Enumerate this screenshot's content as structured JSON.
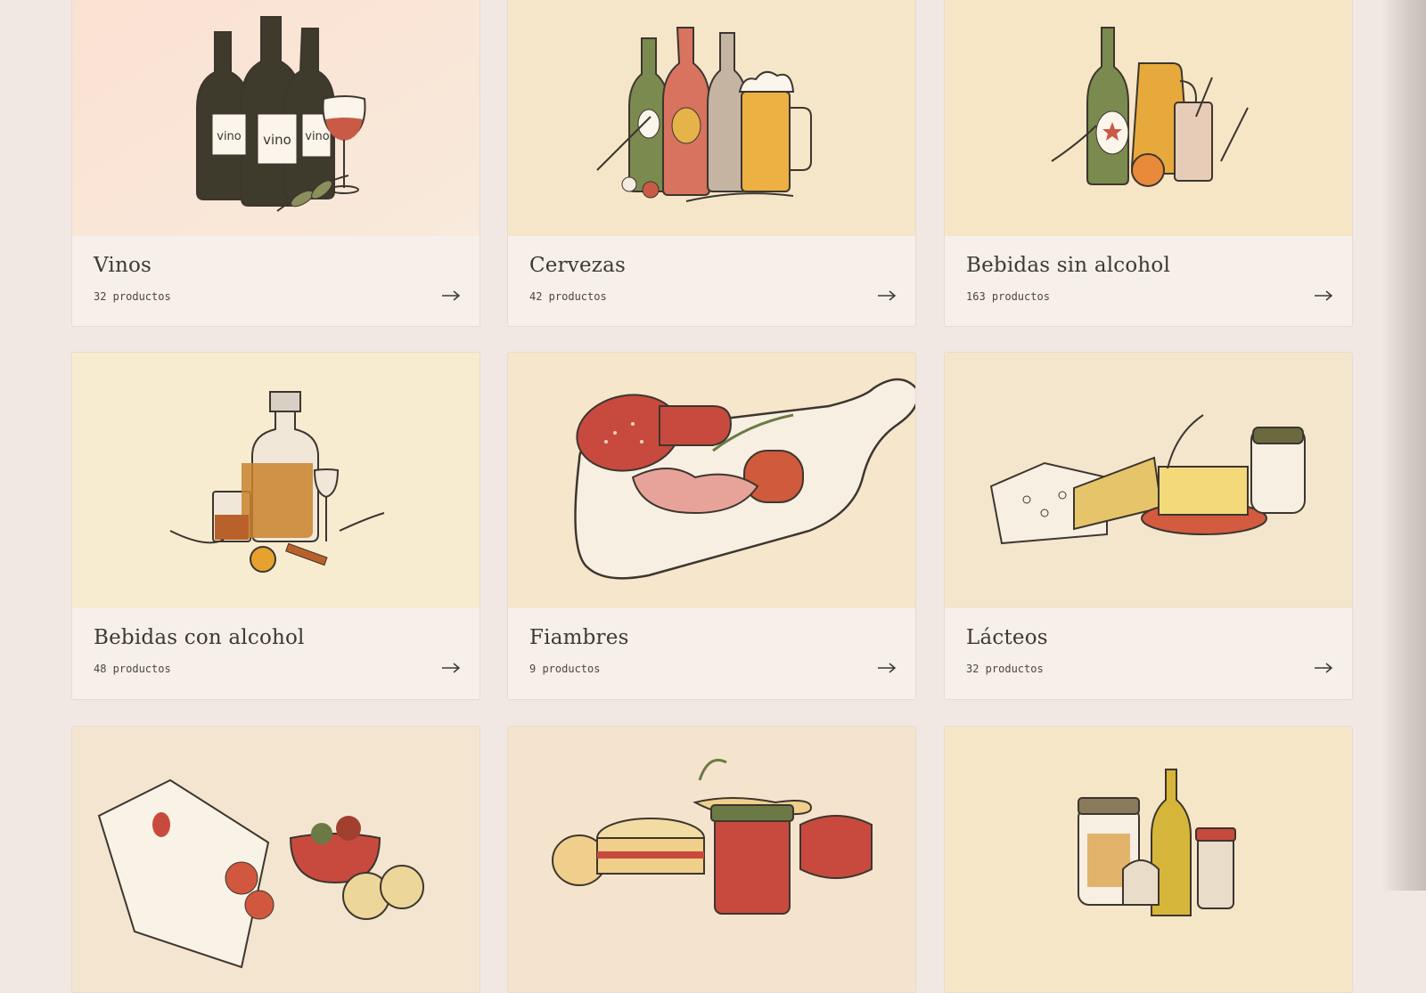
{
  "categories": [
    {
      "title": "Vinos",
      "count": "32 productos",
      "image": "wine-bottles-illustration"
    },
    {
      "title": "Cervezas",
      "count": "42 productos",
      "image": "beer-bottles-illustration"
    },
    {
      "title": "Bebidas sin alcohol",
      "count": "163 productos",
      "image": "soft-drinks-illustration"
    },
    {
      "title": "Bebidas con alcohol",
      "count": "48 productos",
      "image": "liquor-decanter-illustration"
    },
    {
      "title": "Fiambres",
      "count": "9 productos",
      "image": "cold-cuts-board-illustration"
    },
    {
      "title": "Lácteos",
      "count": "32 productos",
      "image": "cheese-butter-illustration"
    },
    {
      "title": "",
      "count": "",
      "image": "snacks-illustration"
    },
    {
      "title": "",
      "count": "",
      "image": "bakery-jams-illustration"
    },
    {
      "title": "",
      "count": "",
      "image": "pantry-jars-illustration"
    }
  ],
  "bottle_labels": {
    "left": "vino",
    "middle": "vino",
    "right": "vino"
  },
  "icons": {
    "card_arrow": "arrow-right-icon"
  },
  "colors": {
    "page_bg": "#f1e8e3",
    "card_bg": "#f7f0ea",
    "ink": "#3f3933",
    "accent_red": "#c95a45",
    "accent_green": "#7b8a4e",
    "accent_gold": "#e6b24a"
  }
}
